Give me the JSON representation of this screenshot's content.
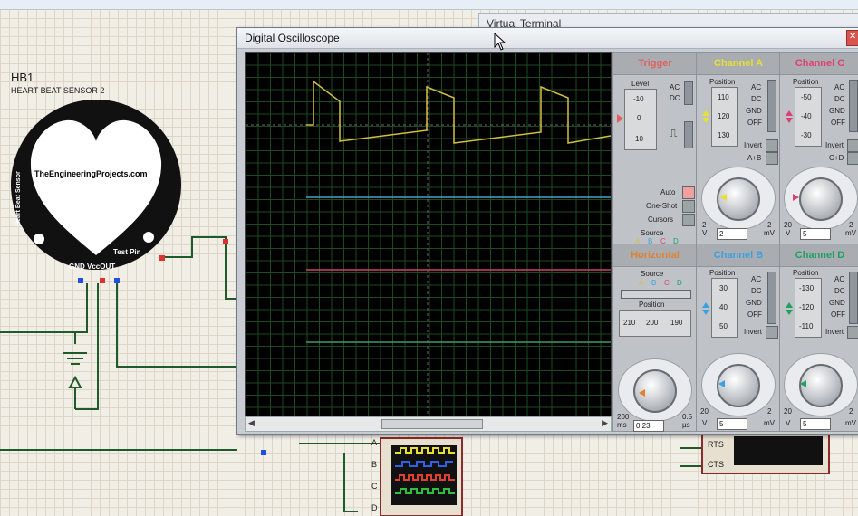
{
  "schematic": {
    "component_ref": "HB1",
    "component_name": "HEART BEAT SENSOR 2",
    "sensor_side_text": "Heart Beat Sensor",
    "sensor_website": "TheEngineeringProjects.com",
    "sensor_testpin": "Test Pin",
    "sensor_pins": "GND VccOUT"
  },
  "virtual_terminal": {
    "title": "Virtual Terminal"
  },
  "oscilloscope": {
    "title": "Digital Oscilloscope",
    "trigger": {
      "title": "Trigger",
      "level_label": "Level",
      "level_values": [
        "-10",
        "0",
        "10"
      ],
      "coupling": [
        "AC",
        "DC"
      ],
      "modes": [
        "Auto",
        "One-Shot",
        "Cursors"
      ],
      "source_label": "Source",
      "source_letters": [
        "A",
        "B",
        "C",
        "D"
      ]
    },
    "channel_a": {
      "title": "Channel A",
      "position_label": "Position",
      "position_values": [
        "110",
        "120",
        "130"
      ],
      "coupling": [
        "AC",
        "DC",
        "GND",
        "OFF"
      ],
      "options": [
        "Invert",
        "A+B"
      ],
      "scale_left": "2",
      "scale_right": "2",
      "unit_left": "V",
      "unit_right": "mV",
      "field": "2"
    },
    "channel_b": {
      "title": "Channel B",
      "position_label": "Position",
      "position_values": [
        "30",
        "40",
        "50"
      ],
      "coupling": [
        "AC",
        "DC",
        "GND",
        "OFF"
      ],
      "options": [
        "Invert"
      ],
      "scale_left": "20",
      "scale_right": "2",
      "unit_left": "V",
      "unit_right": "mV",
      "field": "5"
    },
    "channel_c": {
      "title": "Channel C",
      "position_label": "Position",
      "position_values": [
        "-50",
        "-40",
        "-30"
      ],
      "coupling": [
        "AC",
        "DC",
        "GND",
        "OFF"
      ],
      "options": [
        "Invert",
        "C+D"
      ],
      "scale_left": "20",
      "scale_right": "2",
      "unit_left": "V",
      "unit_right": "mV",
      "field": "5"
    },
    "channel_d": {
      "title": "Channel D",
      "position_label": "Position",
      "position_values": [
        "-130",
        "-120",
        "-110"
      ],
      "coupling": [
        "AC",
        "DC",
        "GND",
        "OFF"
      ],
      "options": [
        "Invert"
      ],
      "scale_left": "20",
      "scale_right": "2",
      "unit_left": "V",
      "unit_right": "mV",
      "field": "5"
    },
    "horizontal": {
      "title": "Horizontal",
      "source_label": "Source",
      "source_letters": [
        "A",
        "B",
        "C",
        "D"
      ],
      "position_label": "Position",
      "position_values": [
        "210",
        "200",
        "190"
      ],
      "scale_left": "200",
      "scale_right": "0.5",
      "unit_left": "ms",
      "unit_right": "µs",
      "field": "0.23"
    }
  },
  "bottom": {
    "pins_left": [
      "A",
      "B",
      "C",
      "D"
    ],
    "pins_right": [
      "RTS",
      "CTS"
    ]
  },
  "colors": {
    "channel_a": "#e8e030",
    "channel_b": "#3aa0e0",
    "channel_c": "#e04070",
    "channel_d": "#20a060",
    "trigger": "#e06060",
    "horizontal": "#e08030",
    "trace_a": "#d4c040",
    "trace_b": "#4aa0c8",
    "trace_c": "#c84860",
    "trace_d": "#3a9a70"
  }
}
